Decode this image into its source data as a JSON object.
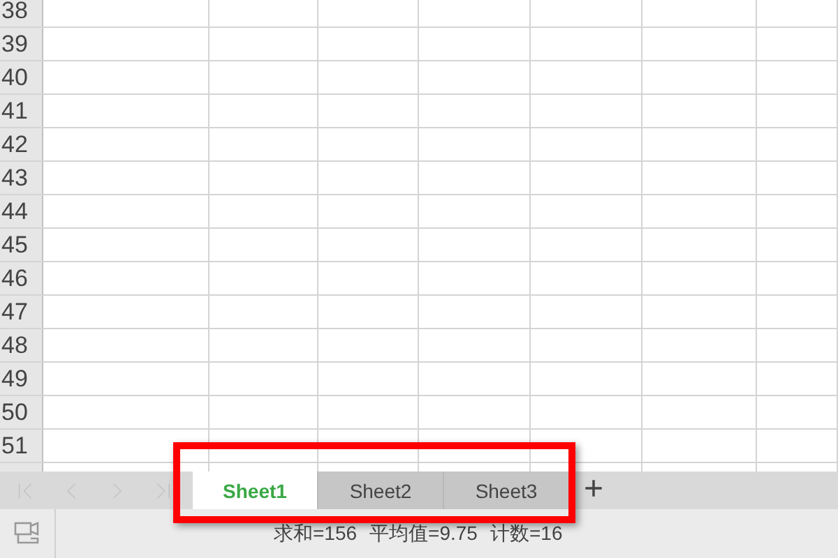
{
  "rows": [
    "38",
    "39",
    "40",
    "41",
    "42",
    "43",
    "44",
    "45",
    "46",
    "47",
    "48",
    "49",
    "50",
    "51"
  ],
  "sheets": [
    {
      "label": "Sheet1",
      "selected": true
    },
    {
      "label": "Sheet2",
      "selected": false
    },
    {
      "label": "Sheet3",
      "selected": false
    }
  ],
  "add_sheet": "+",
  "status_bar": [
    "求和=156",
    "平均值=9.75",
    "计数=16"
  ]
}
